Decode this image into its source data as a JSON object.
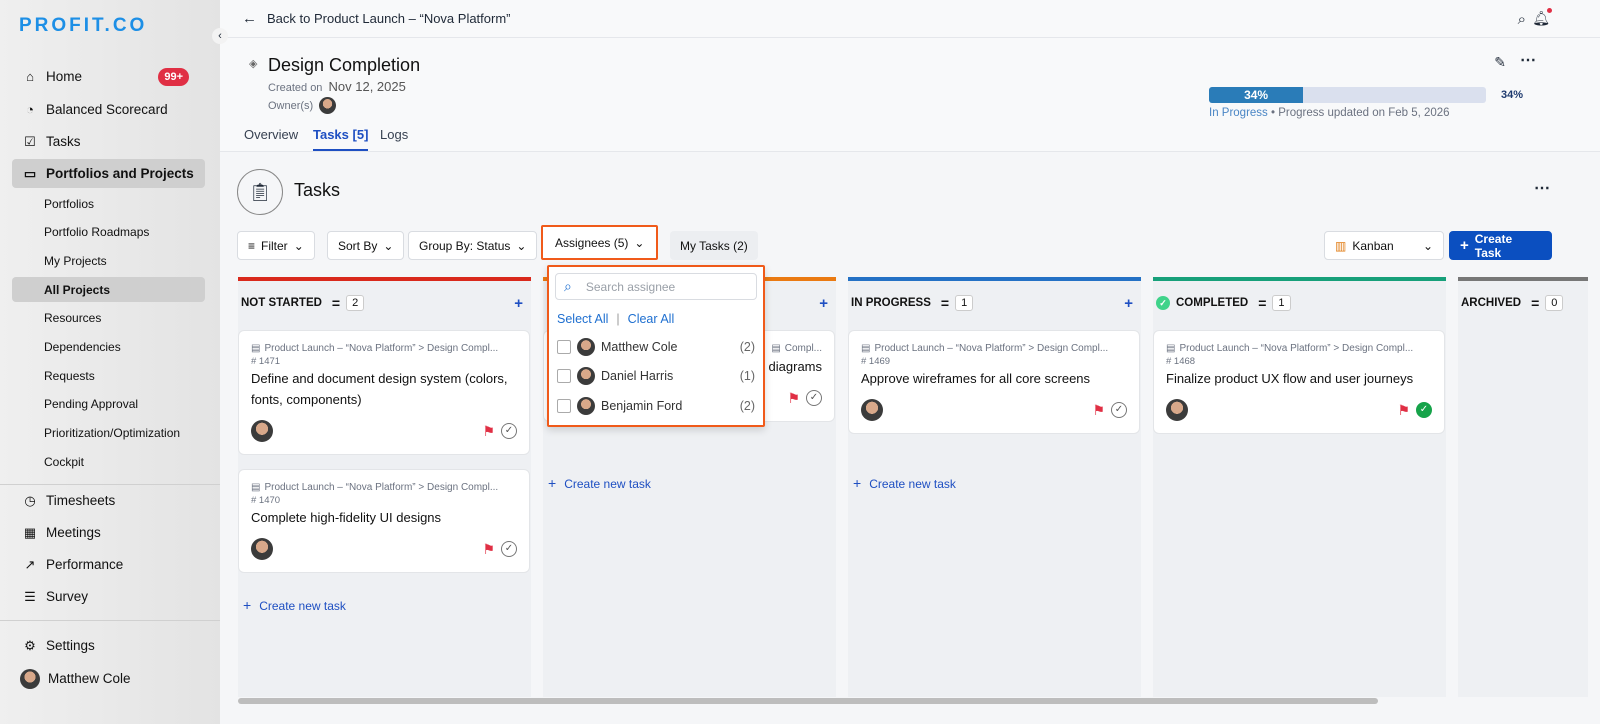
{
  "sidebar": {
    "logo": "PROFIT.CO",
    "home": "Home",
    "home_badge": "99+",
    "balanced": "Balanced Scorecard",
    "tasks": "Tasks",
    "portfolios_projects": "Portfolios and Projects",
    "sub": [
      "Portfolios",
      "Portfolio Roadmaps",
      "My Projects",
      "All Projects",
      "Resources",
      "Dependencies",
      "Requests",
      "Pending Approval",
      "Prioritization/Optimization",
      "Cockpit"
    ],
    "timesheets": "Timesheets",
    "meetings": "Meetings",
    "performance": "Performance",
    "survey": "Survey",
    "settings": "Settings",
    "user": "Matthew Cole"
  },
  "topbar": {
    "back": "Back to Product Launch – “Nova Platform”"
  },
  "header": {
    "title": "Design Completion",
    "created_label": "Created on",
    "created": "Nov 12, 2025",
    "owners_label": "Owner(s)",
    "progress_percent": 34,
    "progress_label": "34%",
    "progress_value": "34%",
    "status": "In Progress",
    "updated": "• Progress updated on Feb 5, 2026",
    "tabs": [
      "Overview",
      "Tasks [5]",
      "Logs"
    ]
  },
  "tasks": {
    "heading": "Tasks",
    "filter": "Filter",
    "sort": "Sort By",
    "group": "Group By: Status",
    "assignees": "Assignees (5)",
    "my_tasks": "My Tasks (2)",
    "view": "Kanban",
    "create": "Create Task"
  },
  "dropdown": {
    "placeholder": "Search assignee",
    "select_all": "Select All",
    "clear_all": "Clear All",
    "options": [
      {
        "name": "Matthew Cole",
        "count": "(2)"
      },
      {
        "name": "Daniel Harris",
        "count": "(1)"
      },
      {
        "name": "Benjamin Ford",
        "count": "(2)"
      }
    ]
  },
  "columns": [
    {
      "name": "NOT STARTED",
      "count": "2",
      "color": "#d9291c",
      "cards": [
        {
          "crumb": "Product Launch – “Nova Platform” > Design Compl...",
          "id": "# 1471",
          "title": "Define and document design system (colors, fonts, components)"
        },
        {
          "crumb": "Product Launch – “Nova Platform” > Design Compl...",
          "id": "# 1470",
          "title": "Complete high-fidelity UI designs"
        }
      ],
      "new": "Create new task"
    },
    {
      "name": "",
      "count": "",
      "color": "#ea7a12",
      "cards": [
        {
          "crumb": "Compl...",
          "id": "",
          "title": "y diagrams"
        }
      ],
      "new": "Create new task"
    },
    {
      "name": "IN PROGRESS",
      "count": "1",
      "color": "#2471c5",
      "cards": [
        {
          "crumb": "Product Launch – “Nova Platform” > Design Compl...",
          "id": "# 1469",
          "title": "Approve wireframes for all core screens"
        }
      ],
      "new": "Create new task"
    },
    {
      "name": "COMPLETED",
      "count": "1",
      "color": "#17a07a",
      "done": true,
      "cards": [
        {
          "crumb": "Product Launch – “Nova Platform” > Design Compl...",
          "id": "# 1468",
          "title": "Finalize product UX flow and user journeys"
        }
      ]
    },
    {
      "name": "ARCHIVED",
      "count": "0",
      "color": "#777777",
      "cards": []
    }
  ]
}
